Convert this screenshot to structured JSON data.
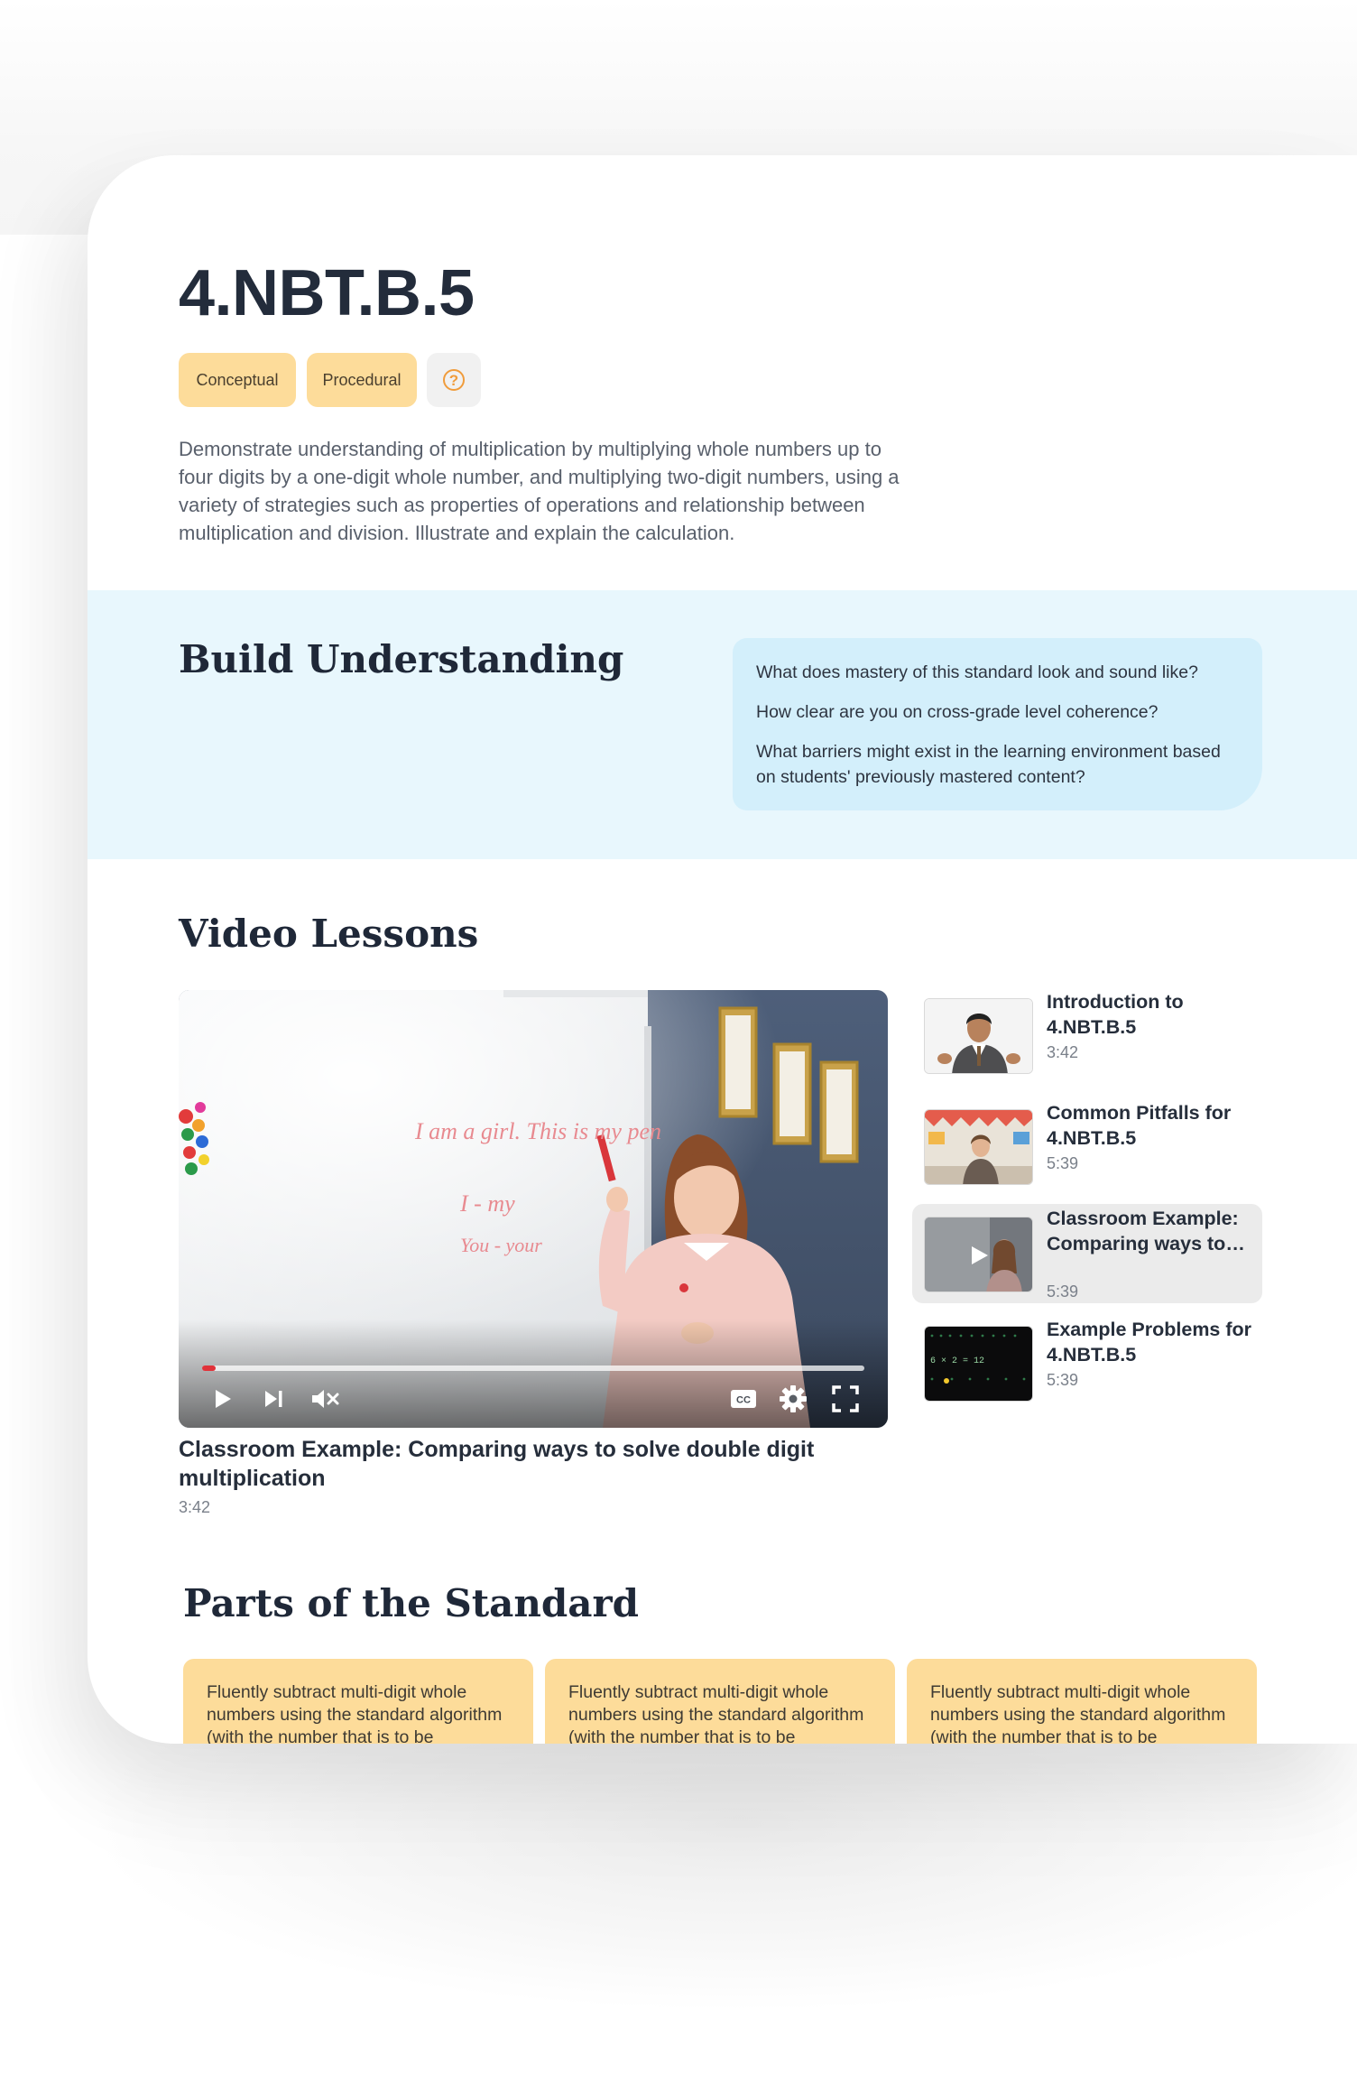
{
  "standard": {
    "code": "4.NBT.B.5",
    "tags": [
      "Conceptual",
      "Procedural"
    ],
    "help_symbol": "?",
    "description": "Demonstrate understanding of multiplication by multiplying whole numbers up to four digits by a one-digit whole number, and multiplying two-digit numbers, using a variety of strategies such as properties of operations and relationship between multiplication and division. Illustrate and explain the calculation."
  },
  "build_understanding": {
    "title": "Build Understanding",
    "questions": [
      "What does mastery of this standard look and sound like?",
      "How clear are you on cross-grade level coherence?",
      "What barriers might exist in the learning environment based on students' previously mastered content?"
    ]
  },
  "video_lessons": {
    "title": "Video Lessons",
    "player": {
      "title": "Classroom Example: Comparing ways to solve double digit multiplication",
      "duration": "3:42",
      "progress": 0.02,
      "whiteboard_lines": [
        "I am a girl. This is my pen",
        "I - my",
        "You - your"
      ],
      "cc_label": "CC"
    },
    "playlist": [
      {
        "title": "Introduction to 4.NBT.B.5",
        "duration": "3:42",
        "active": false
      },
      {
        "title": "Common Pitfalls for 4.NBT.B.5",
        "duration": "5:39",
        "active": false
      },
      {
        "title": "Classroom Example: Comparing ways to solve double digit multiplication",
        "duration": "5:39",
        "active": true
      },
      {
        "title": "Example Problems for 4.NBT.B.5",
        "duration": "5:39",
        "active": false
      }
    ],
    "thumbnail_math": {
      "line1": "6 × 2 = 12"
    }
  },
  "parts": {
    "title": "Parts of the Standard",
    "cards": [
      {
        "text": "Fluently subtract multi-digit whole numbers using the standard algorithm (with the number that is to be"
      },
      {
        "text": "Fluently subtract multi-digit whole numbers using the standard algorithm (with the number that is to be"
      },
      {
        "text": "Fluently subtract multi-digit whole numbers using the standard algorithm (with the number that is to be"
      }
    ]
  },
  "colors": {
    "tag_bg": "#fddc9a",
    "build_bg": "#e8f7fd",
    "question_bg": "#d3effb",
    "progress_red": "#e0323a",
    "help_orange": "#f09c3c"
  },
  "icons": [
    "help-icon",
    "play-icon",
    "skip-next-icon",
    "mute-icon",
    "closed-captions-icon",
    "settings-icon",
    "fullscreen-icon"
  ]
}
